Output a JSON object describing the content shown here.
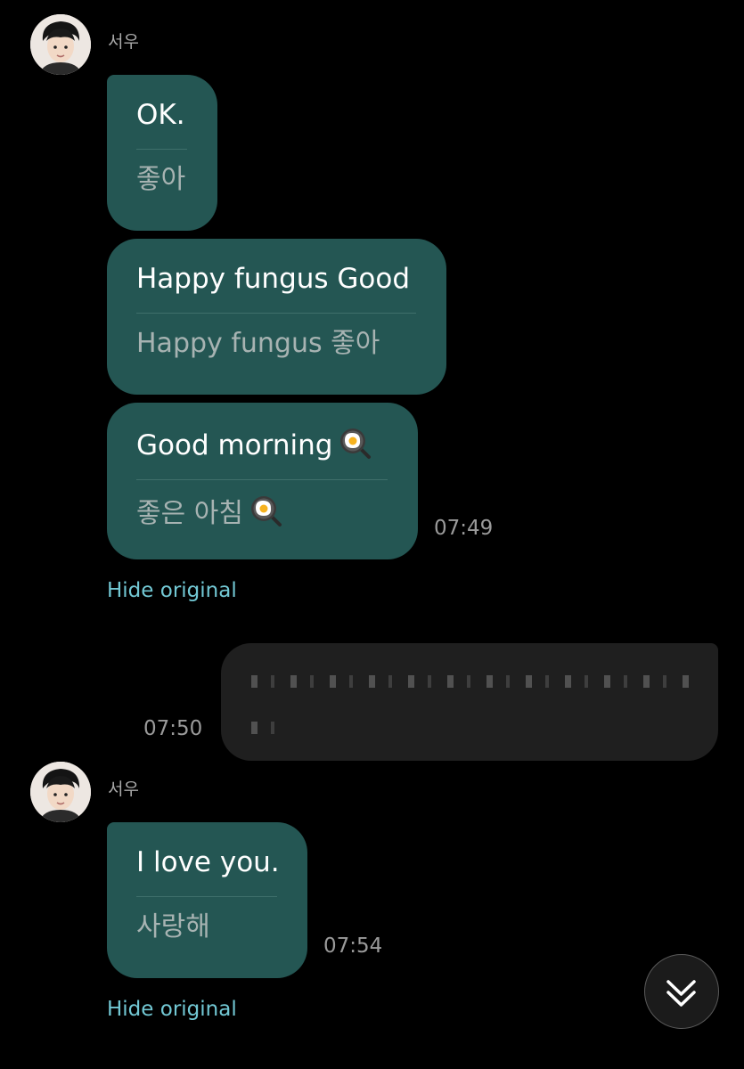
{
  "messages": [
    {
      "sender": "서우",
      "bubbles": [
        {
          "original": "OK.",
          "translation": "좋아"
        },
        {
          "original": "Happy fungus Good",
          "translation": "Happy fungus 좋아"
        },
        {
          "original": "Good morning",
          "translation": "좋은 아침",
          "emoji": "fried-egg-icon"
        }
      ],
      "time": "07:49",
      "hide_original": "Hide original"
    },
    {
      "sent": true,
      "content": "",
      "time": "07:50",
      "redacted": true
    },
    {
      "sender": "서우",
      "bubbles": [
        {
          "original": "I love you.",
          "translation": "사랑해"
        }
      ],
      "time": "07:54",
      "hide_original": "Hide original"
    }
  ],
  "scroll_button": {
    "icon": "double-chevron-down-icon"
  },
  "colors": {
    "background": "#000000",
    "received_bubble": "#245653",
    "sent_bubble": "#1f1f1f",
    "link": "#72c8d4",
    "timestamp": "#9a9a9a"
  }
}
